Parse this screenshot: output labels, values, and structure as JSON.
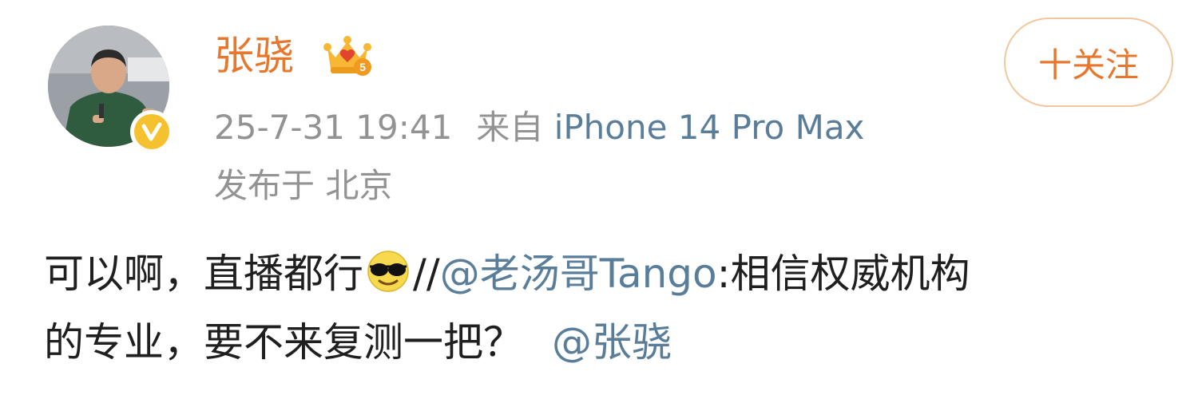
{
  "user": {
    "name": "张骁",
    "avatar_icon": "person-avatar",
    "verified_icon": "verified-v-badge",
    "level_icon": "crown-level-badge"
  },
  "follow_button": {
    "label": "十关注"
  },
  "meta": {
    "timestamp": "25-7-31 19:41",
    "source_prefix": "来自",
    "device": "iPhone 14 Pro Max",
    "location": "发布于 北京"
  },
  "post": {
    "part1": "可以啊，直播都行",
    "emoji": "cool-sunglasses-emoji",
    "separator": "//",
    "mention1": "@老汤哥Tango",
    "part2": ":相信权威机构",
    "line2": "的专业，要不来复测一把？",
    "mention2": "@张骁"
  },
  "colors": {
    "username": "#e8772e",
    "link": "#5a7e99",
    "meta_gray": "#939393",
    "follow_border": "#f2c79e",
    "text": "#1f1f1f"
  }
}
